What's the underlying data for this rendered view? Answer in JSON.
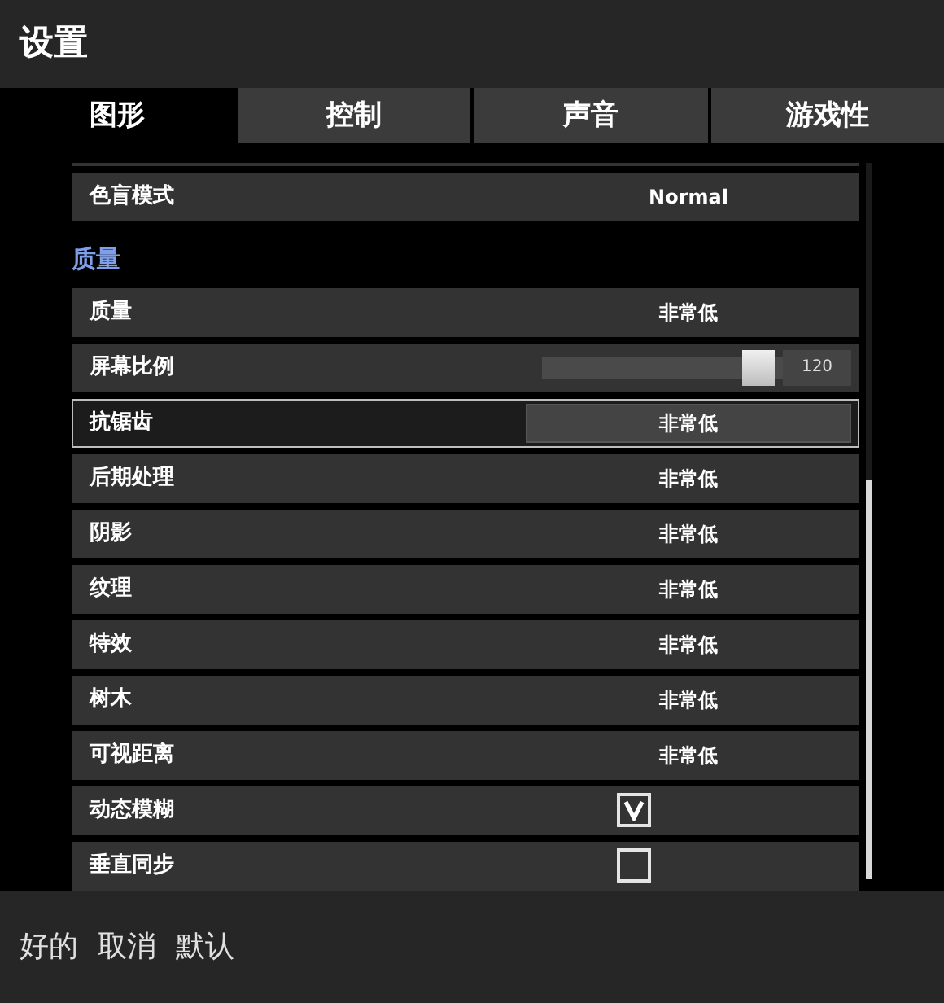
{
  "window": {
    "title": "设置"
  },
  "tabs": [
    {
      "label": "图形",
      "selected": true
    },
    {
      "label": "控制",
      "selected": false
    },
    {
      "label": "声音",
      "selected": false
    },
    {
      "label": "游戏性",
      "selected": false
    }
  ],
  "top_rows": [
    {
      "kind": "select",
      "label": "色盲模式",
      "value": "Normal",
      "selected": false
    }
  ],
  "section": {
    "title": "质量"
  },
  "rows": [
    {
      "kind": "select",
      "label": "质量",
      "value": "非常低",
      "selected": false
    },
    {
      "kind": "slider",
      "label": "屏幕比例",
      "value": "120",
      "level": 0.9,
      "selected": false
    },
    {
      "kind": "select",
      "label": "抗锯齿",
      "value": "非常低",
      "selected": true
    },
    {
      "kind": "select",
      "label": "后期处理",
      "value": "非常低",
      "selected": false
    },
    {
      "kind": "select",
      "label": "阴影",
      "value": "非常低",
      "selected": false
    },
    {
      "kind": "select",
      "label": "纹理",
      "value": "非常低",
      "selected": false
    },
    {
      "kind": "select",
      "label": "特效",
      "value": "非常低",
      "selected": false
    },
    {
      "kind": "select",
      "label": "树木",
      "value": "非常低",
      "selected": false
    },
    {
      "kind": "select",
      "label": "可视距离",
      "value": "非常低",
      "selected": false
    },
    {
      "kind": "checkbox",
      "label": "动态模糊",
      "checked": true,
      "selected": false
    },
    {
      "kind": "checkbox",
      "label": "垂直同步",
      "checked": false,
      "selected": false
    }
  ],
  "buttons": [
    "好的",
    "取消",
    "默认"
  ]
}
